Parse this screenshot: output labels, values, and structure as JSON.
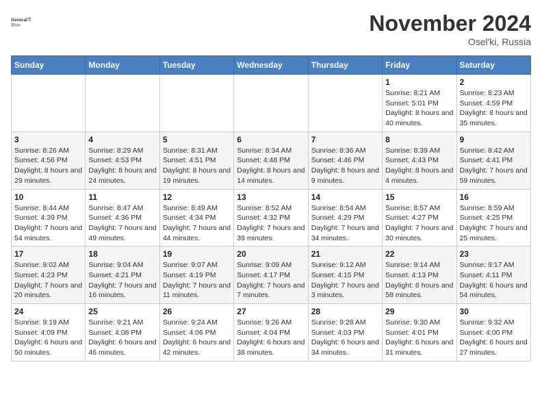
{
  "logo": {
    "line1": "General",
    "line2": "Blue"
  },
  "title": "November 2024",
  "location": "Osel'ki, Russia",
  "weekdays": [
    "Sunday",
    "Monday",
    "Tuesday",
    "Wednesday",
    "Thursday",
    "Friday",
    "Saturday"
  ],
  "weeks": [
    [
      {
        "day": "",
        "info": ""
      },
      {
        "day": "",
        "info": ""
      },
      {
        "day": "",
        "info": ""
      },
      {
        "day": "",
        "info": ""
      },
      {
        "day": "",
        "info": ""
      },
      {
        "day": "1",
        "info": "Sunrise: 8:21 AM\nSunset: 5:01 PM\nDaylight: 8 hours and 40 minutes."
      },
      {
        "day": "2",
        "info": "Sunrise: 8:23 AM\nSunset: 4:59 PM\nDaylight: 8 hours and 35 minutes."
      }
    ],
    [
      {
        "day": "3",
        "info": "Sunrise: 8:26 AM\nSunset: 4:56 PM\nDaylight: 8 hours and 29 minutes."
      },
      {
        "day": "4",
        "info": "Sunrise: 8:29 AM\nSunset: 4:53 PM\nDaylight: 8 hours and 24 minutes."
      },
      {
        "day": "5",
        "info": "Sunrise: 8:31 AM\nSunset: 4:51 PM\nDaylight: 8 hours and 19 minutes."
      },
      {
        "day": "6",
        "info": "Sunrise: 8:34 AM\nSunset: 4:48 PM\nDaylight: 8 hours and 14 minutes."
      },
      {
        "day": "7",
        "info": "Sunrise: 8:36 AM\nSunset: 4:46 PM\nDaylight: 8 hours and 9 minutes."
      },
      {
        "day": "8",
        "info": "Sunrise: 8:39 AM\nSunset: 4:43 PM\nDaylight: 8 hours and 4 minutes."
      },
      {
        "day": "9",
        "info": "Sunrise: 8:42 AM\nSunset: 4:41 PM\nDaylight: 7 hours and 59 minutes."
      }
    ],
    [
      {
        "day": "10",
        "info": "Sunrise: 8:44 AM\nSunset: 4:39 PM\nDaylight: 7 hours and 54 minutes."
      },
      {
        "day": "11",
        "info": "Sunrise: 8:47 AM\nSunset: 4:36 PM\nDaylight: 7 hours and 49 minutes."
      },
      {
        "day": "12",
        "info": "Sunrise: 8:49 AM\nSunset: 4:34 PM\nDaylight: 7 hours and 44 minutes."
      },
      {
        "day": "13",
        "info": "Sunrise: 8:52 AM\nSunset: 4:32 PM\nDaylight: 7 hours and 39 minutes."
      },
      {
        "day": "14",
        "info": "Sunrise: 8:54 AM\nSunset: 4:29 PM\nDaylight: 7 hours and 34 minutes."
      },
      {
        "day": "15",
        "info": "Sunrise: 8:57 AM\nSunset: 4:27 PM\nDaylight: 7 hours and 30 minutes."
      },
      {
        "day": "16",
        "info": "Sunrise: 8:59 AM\nSunset: 4:25 PM\nDaylight: 7 hours and 25 minutes."
      }
    ],
    [
      {
        "day": "17",
        "info": "Sunrise: 9:02 AM\nSunset: 4:23 PM\nDaylight: 7 hours and 20 minutes."
      },
      {
        "day": "18",
        "info": "Sunrise: 9:04 AM\nSunset: 4:21 PM\nDaylight: 7 hours and 16 minutes."
      },
      {
        "day": "19",
        "info": "Sunrise: 9:07 AM\nSunset: 4:19 PM\nDaylight: 7 hours and 11 minutes."
      },
      {
        "day": "20",
        "info": "Sunrise: 9:09 AM\nSunset: 4:17 PM\nDaylight: 7 hours and 7 minutes."
      },
      {
        "day": "21",
        "info": "Sunrise: 9:12 AM\nSunset: 4:15 PM\nDaylight: 7 hours and 3 minutes."
      },
      {
        "day": "22",
        "info": "Sunrise: 9:14 AM\nSunset: 4:13 PM\nDaylight: 6 hours and 58 minutes."
      },
      {
        "day": "23",
        "info": "Sunrise: 9:17 AM\nSunset: 4:11 PM\nDaylight: 6 hours and 54 minutes."
      }
    ],
    [
      {
        "day": "24",
        "info": "Sunrise: 9:19 AM\nSunset: 4:09 PM\nDaylight: 6 hours and 50 minutes."
      },
      {
        "day": "25",
        "info": "Sunrise: 9:21 AM\nSunset: 4:08 PM\nDaylight: 6 hours and 46 minutes."
      },
      {
        "day": "26",
        "info": "Sunrise: 9:24 AM\nSunset: 4:06 PM\nDaylight: 6 hours and 42 minutes."
      },
      {
        "day": "27",
        "info": "Sunrise: 9:26 AM\nSunset: 4:04 PM\nDaylight: 6 hours and 38 minutes."
      },
      {
        "day": "28",
        "info": "Sunrise: 9:28 AM\nSunset: 4:03 PM\nDaylight: 6 hours and 34 minutes."
      },
      {
        "day": "29",
        "info": "Sunrise: 9:30 AM\nSunset: 4:01 PM\nDaylight: 6 hours and 31 minutes."
      },
      {
        "day": "30",
        "info": "Sunrise: 9:32 AM\nSunset: 4:00 PM\nDaylight: 6 hours and 27 minutes."
      }
    ]
  ]
}
